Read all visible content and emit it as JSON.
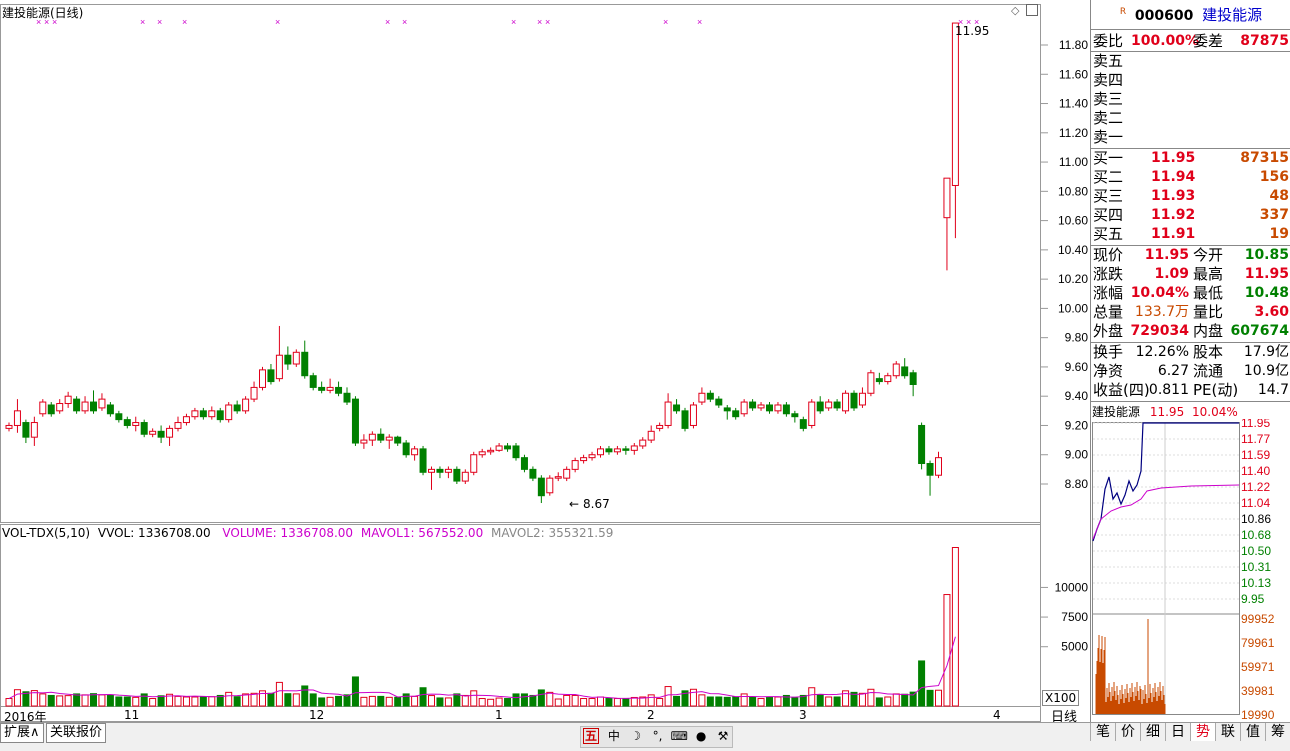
{
  "chart_title": "建投能源(日线)",
  "kline": {
    "y_ticks": [
      "11.80",
      "11.60",
      "11.40",
      "11.20",
      "11.00",
      "10.80",
      "10.60",
      "10.40",
      "10.20",
      "10.00",
      "9.80",
      "9.60",
      "9.40",
      "9.20",
      "9.00",
      "8.80"
    ],
    "high_label": "11.95",
    "low_label": "8.67"
  },
  "volume": {
    "indicator": "VOL-TDX(5,10)",
    "vvol": "VVOL: 1336708.00",
    "volume": "VOLUME: 1336708.00",
    "mavol1": "MAVOL1: 567552.00",
    "mavol2": "MAVOL2: 355321.59",
    "y_ticks": [
      "10000",
      "7500",
      "5000"
    ],
    "unit": "X100"
  },
  "x_axis": {
    "labels": [
      "2016年",
      "11",
      "12",
      "1",
      "2",
      "3",
      "4"
    ],
    "period": "日线"
  },
  "chart_data": {
    "type": "candlestick",
    "title": "建投能源(日线)",
    "ylim": [
      8.6,
      11.95
    ],
    "candles": [
      [
        9.18,
        9.2,
        9.16,
        9.22
      ],
      [
        9.2,
        9.3,
        9.15,
        9.38
      ],
      [
        9.22,
        9.12,
        9.08,
        9.24
      ],
      [
        9.12,
        9.22,
        9.06,
        9.26
      ],
      [
        9.28,
        9.36,
        9.26,
        9.38
      ],
      [
        9.34,
        9.28,
        9.26,
        9.36
      ],
      [
        9.3,
        9.35,
        9.28,
        9.38
      ],
      [
        9.35,
        9.4,
        9.32,
        9.43
      ],
      [
        9.38,
        9.3,
        9.28,
        9.4
      ],
      [
        9.3,
        9.36,
        9.28,
        9.4
      ],
      [
        9.36,
        9.3,
        9.28,
        9.44
      ],
      [
        9.32,
        9.38,
        9.3,
        9.42
      ],
      [
        9.34,
        9.28,
        9.26,
        9.36
      ],
      [
        9.28,
        9.24,
        9.22,
        9.3
      ],
      [
        9.24,
        9.2,
        9.18,
        9.26
      ],
      [
        9.2,
        9.22,
        9.16,
        9.26
      ],
      [
        9.22,
        9.14,
        9.12,
        9.24
      ],
      [
        9.14,
        9.16,
        9.12,
        9.18
      ],
      [
        9.16,
        9.12,
        9.08,
        9.2
      ],
      [
        9.12,
        9.18,
        9.06,
        9.2
      ],
      [
        9.18,
        9.22,
        9.16,
        9.26
      ],
      [
        9.22,
        9.26,
        9.2,
        9.28
      ],
      [
        9.26,
        9.3,
        9.24,
        9.32
      ],
      [
        9.3,
        9.26,
        9.24,
        9.32
      ],
      [
        9.26,
        9.3,
        9.24,
        9.33
      ],
      [
        9.3,
        9.24,
        9.22,
        9.32
      ],
      [
        9.24,
        9.34,
        9.22,
        9.36
      ],
      [
        9.34,
        9.3,
        9.28,
        9.37
      ],
      [
        9.3,
        9.38,
        9.28,
        9.4
      ],
      [
        9.38,
        9.46,
        9.36,
        9.5
      ],
      [
        9.46,
        9.58,
        9.44,
        9.6
      ],
      [
        9.58,
        9.5,
        9.48,
        9.62
      ],
      [
        9.52,
        9.68,
        9.5,
        9.88
      ],
      [
        9.68,
        9.62,
        9.58,
        9.74
      ],
      [
        9.62,
        9.7,
        9.6,
        9.72
      ],
      [
        9.7,
        9.54,
        9.52,
        9.78
      ],
      [
        9.54,
        9.46,
        9.44,
        9.56
      ],
      [
        9.46,
        9.44,
        9.42,
        9.5
      ],
      [
        9.44,
        9.46,
        9.42,
        9.52
      ],
      [
        9.46,
        9.42,
        9.4,
        9.5
      ],
      [
        9.42,
        9.36,
        9.34,
        9.46
      ],
      [
        9.38,
        9.08,
        9.06,
        9.4
      ],
      [
        9.08,
        9.1,
        9.04,
        9.14
      ],
      [
        9.1,
        9.14,
        9.06,
        9.16
      ],
      [
        9.14,
        9.1,
        9.08,
        9.18
      ],
      [
        9.1,
        9.12,
        9.04,
        9.14
      ],
      [
        9.12,
        9.08,
        9.06,
        9.13
      ],
      [
        9.08,
        9,
        8.98,
        9.1
      ],
      [
        9.0,
        9.04,
        8.96,
        9.06
      ],
      [
        9.04,
        8.88,
        8.86,
        9.06
      ],
      [
        8.88,
        8.9,
        8.76,
        8.92
      ],
      [
        8.9,
        8.88,
        8.84,
        8.92
      ],
      [
        8.88,
        8.9,
        8.84,
        8.92
      ],
      [
        8.9,
        8.82,
        8.8,
        8.92
      ],
      [
        8.82,
        8.88,
        8.8,
        8.9
      ],
      [
        8.88,
        9.0,
        8.86,
        9.02
      ],
      [
        9.0,
        9.02,
        8.98,
        9.04
      ],
      [
        9.02,
        9.03,
        9.0,
        9.05
      ],
      [
        9.03,
        9.06,
        9.02,
        9.08
      ],
      [
        9.06,
        9.04,
        9.02,
        9.08
      ],
      [
        9.06,
        8.98,
        8.96,
        9.08
      ],
      [
        8.98,
        8.9,
        8.88,
        9.0
      ],
      [
        8.9,
        8.84,
        8.82,
        8.92
      ],
      [
        8.84,
        8.72,
        8.67,
        8.86
      ],
      [
        8.74,
        8.84,
        8.72,
        8.86
      ],
      [
        8.84,
        8.85,
        8.82,
        8.88
      ],
      [
        8.84,
        8.9,
        8.82,
        8.92
      ],
      [
        8.9,
        8.96,
        8.88,
        8.98
      ],
      [
        8.96,
        8.98,
        8.94,
        9.0
      ],
      [
        8.98,
        9.0,
        8.96,
        9.02
      ],
      [
        9.0,
        9.04,
        8.98,
        9.06
      ],
      [
        9.04,
        9.02,
        9.0,
        9.06
      ],
      [
        9.02,
        9.04,
        9.0,
        9.06
      ],
      [
        9.04,
        9.03,
        9.0,
        9.06
      ],
      [
        9.03,
        9.06,
        9.0,
        9.08
      ],
      [
        9.06,
        9.1,
        9.04,
        9.12
      ],
      [
        9.1,
        9.16,
        9.08,
        9.2
      ],
      [
        9.18,
        9.2,
        9.16,
        9.22
      ],
      [
        9.2,
        9.36,
        9.18,
        9.42
      ],
      [
        9.34,
        9.3,
        9.28,
        9.38
      ],
      [
        9.3,
        9.18,
        9.16,
        9.32
      ],
      [
        9.2,
        9.34,
        9.18,
        9.36
      ],
      [
        9.36,
        9.42,
        9.34,
        9.46
      ],
      [
        9.42,
        9.38,
        9.36,
        9.44
      ],
      [
        9.38,
        9.34,
        9.32,
        9.4
      ],
      [
        9.32,
        9.3,
        9.24,
        9.34
      ],
      [
        9.3,
        9.26,
        9.24,
        9.32
      ],
      [
        9.28,
        9.36,
        9.26,
        9.38
      ],
      [
        9.36,
        9.32,
        9.3,
        9.38
      ],
      [
        9.32,
        9.34,
        9.3,
        9.36
      ],
      [
        9.34,
        9.3,
        9.28,
        9.36
      ],
      [
        9.3,
        9.34,
        9.28,
        9.36
      ],
      [
        9.34,
        9.28,
        9.26,
        9.36
      ],
      [
        9.28,
        9.26,
        9.22,
        9.3
      ],
      [
        9.24,
        9.18,
        9.16,
        9.26
      ],
      [
        9.2,
        9.36,
        9.18,
        9.38
      ],
      [
        9.36,
        9.3,
        9.28,
        9.4
      ],
      [
        9.32,
        9.36,
        9.3,
        9.38
      ],
      [
        9.36,
        9.32,
        9.3,
        9.38
      ],
      [
        9.3,
        9.42,
        9.28,
        9.44
      ],
      [
        9.42,
        9.32,
        9.3,
        9.44
      ],
      [
        9.34,
        9.42,
        9.32,
        9.46
      ],
      [
        9.42,
        9.56,
        9.4,
        9.58
      ],
      [
        9.52,
        9.5,
        9.48,
        9.56
      ],
      [
        9.5,
        9.54,
        9.48,
        9.56
      ],
      [
        9.54,
        9.62,
        9.52,
        9.64
      ],
      [
        9.6,
        9.54,
        9.52,
        9.66
      ],
      [
        9.56,
        9.48,
        9.4,
        9.58
      ],
      [
        9.2,
        8.94,
        8.9,
        9.22
      ],
      [
        8.94,
        8.86,
        8.72,
        8.96
      ],
      [
        8.86,
        8.98,
        8.84,
        9.02
      ],
      [
        10.62,
        10.89,
        10.26,
        10.89
      ],
      [
        10.84,
        11.95,
        10.48,
        11.95
      ]
    ]
  },
  "quote": {
    "code": "000600",
    "name": "建投能源",
    "r_tag": "R",
    "weibi_label": "委比",
    "weibi_value": "100.00%",
    "weicha_label": "委差",
    "weicha_value": "87875",
    "sells": [
      "卖五",
      "卖四",
      "卖三",
      "卖二",
      "卖一"
    ],
    "buys": [
      {
        "label": "买一",
        "price": "11.95",
        "vol": "87315"
      },
      {
        "label": "买二",
        "price": "11.94",
        "vol": "156"
      },
      {
        "label": "买三",
        "price": "11.93",
        "vol": "48"
      },
      {
        "label": "买四",
        "price": "11.92",
        "vol": "337"
      },
      {
        "label": "买五",
        "price": "11.91",
        "vol": "19"
      }
    ],
    "stats": [
      {
        "l1": "现价",
        "v1": "11.95",
        "l2": "今开",
        "v2": "10.85"
      },
      {
        "l1": "涨跌",
        "v1": "1.09",
        "l2": "最高",
        "v2": "11.95"
      },
      {
        "l1": "涨幅",
        "v1": "10.04%",
        "l2": "最低",
        "v2": "10.48"
      },
      {
        "l1": "总量",
        "v1": "133.7万",
        "l2": "量比",
        "v2": "3.60"
      },
      {
        "l1": "外盘",
        "v1": "729034",
        "l2": "内盘",
        "v2": "607674"
      }
    ],
    "fund": [
      {
        "l1": "换手",
        "v1": "12.26%",
        "l2": "股本",
        "v2": "17.9亿"
      },
      {
        "l1": "净资",
        "v1": "6.27",
        "l2": "流通",
        "v2": "10.9亿"
      },
      {
        "l1": "收益(四)",
        "v1": "0.811",
        "l2": "PE(动)",
        "v2": "14.7"
      }
    ]
  },
  "mini": {
    "name": "建投能源",
    "price": "11.95",
    "pct": "10.04%",
    "price_ticks": [
      "11.95",
      "11.77",
      "11.59",
      "11.40",
      "11.22",
      "11.04",
      "10.86",
      "10.68",
      "10.50",
      "10.31",
      "10.13",
      "9.95"
    ],
    "vol_ticks": [
      "99952",
      "79961",
      "59971",
      "39981",
      "19990"
    ]
  },
  "tabs": {
    "left": [
      "扩展∧",
      "关联报价"
    ],
    "right": [
      "笔",
      "价",
      "细",
      "日",
      "势",
      "联",
      "值",
      "筹"
    ]
  },
  "colors": {
    "up": "#e0001a",
    "down": "#008000",
    "ma": "#cc00cc"
  }
}
